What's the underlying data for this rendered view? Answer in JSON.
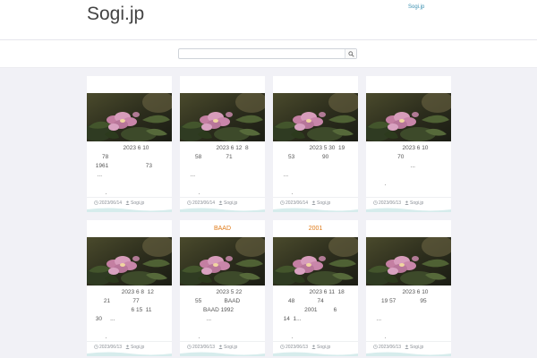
{
  "site": {
    "title": "Sogi.jp",
    "header_link": "Sogi.jp"
  },
  "search": {
    "placeholder": "",
    "value": "",
    "button_icon": "search-icon"
  },
  "colors": {
    "background": "#f1f1f6",
    "card": "#ffffff",
    "accent": "#e07b18",
    "link": "#3a8fb0"
  },
  "cards": [
    {
      "head": "",
      "excerpt": "                  2023 6 10\n     78\n 1961                       73\n  ...\n\n       .",
      "date": "2023/06/14",
      "author": "Sogi.jp"
    },
    {
      "head": "",
      "excerpt": "                  2023 6 12  8\n     58               71\n\n  ...\n\n       .",
      "date": "2023/06/14",
      "author": "Sogi.jp"
    },
    {
      "head": "",
      "excerpt": "                  2023 5 30  19\n     53                 90\n\n  ...\n\n       .",
      "date": "2023/06/14",
      "author": "Sogi.jp"
    },
    {
      "head": "",
      "excerpt": "                  2023 6 10\n               70\n                       ...\n\n       .",
      "date": "2023/06/13",
      "author": "Sogi.jp"
    },
    {
      "head": "",
      "excerpt": "                 2023 6 8  12\n      21              77\n                       6 15  11\n 30     ...\n\n       .",
      "date": "2023/06/13",
      "author": "Sogi.jp"
    },
    {
      "head": "BAAD",
      "excerpt": "                  2023 5 22\n     55              BAAD\n          BAAD 1992\n            ...\n\n       .",
      "date": "2023/06/13",
      "author": "Sogi.jp"
    },
    {
      "head": "2001",
      "excerpt": "                  2023 6 11  18\n     48              74\n               2001          6\n  14  1...\n\n       .",
      "date": "2023/06/13",
      "author": "Sogi.jp"
    },
    {
      "head": "",
      "excerpt": "                  2023 6 10\n     19 57               95\n\n  ...\n\n       .",
      "date": "2023/06/13",
      "author": "Sogi.jp"
    }
  ]
}
